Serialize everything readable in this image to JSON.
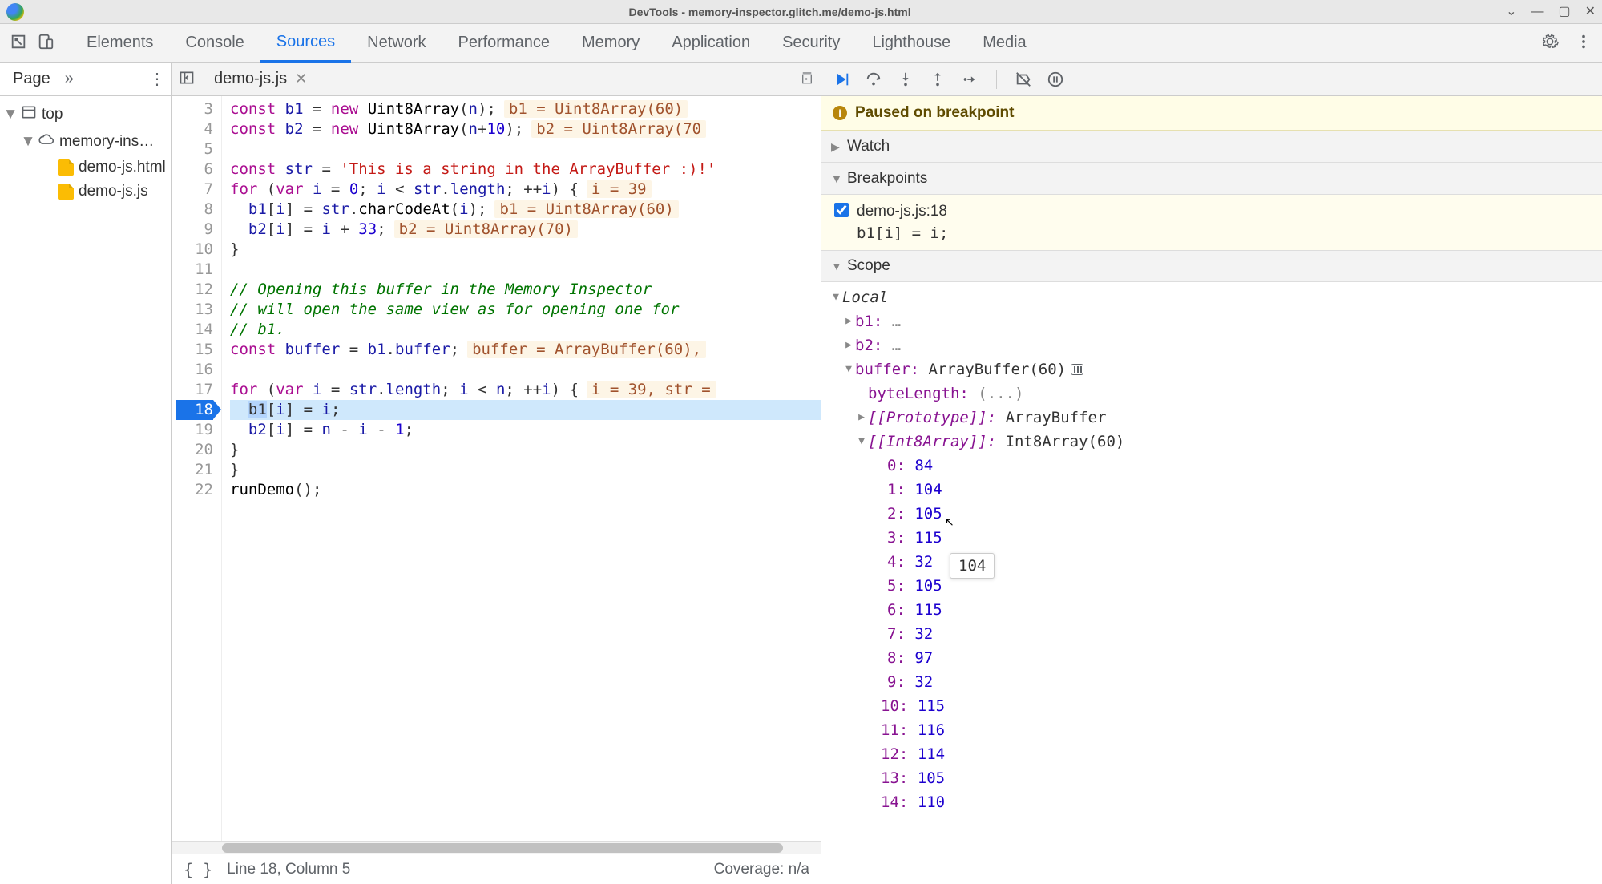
{
  "window": {
    "title": "DevTools - memory-inspector.glitch.me/demo-js.html"
  },
  "panel_tabs": [
    "Elements",
    "Console",
    "Sources",
    "Network",
    "Performance",
    "Memory",
    "Application",
    "Security",
    "Lighthouse",
    "Media"
  ],
  "active_panel": "Sources",
  "navigator": {
    "tab_label": "Page",
    "top_label": "top",
    "domain_label": "memory-ins…",
    "files": [
      "demo-js.html",
      "demo-js.js"
    ]
  },
  "open_file_tab": "demo-js.js",
  "editor": {
    "first_line_number": 3,
    "breakpoint_line": 18,
    "lines": [
      {
        "n": 3,
        "html": "<span class='tok-kw'>const</span> <span class='tok-var'>b1</span> <span class='tok-op'>=</span> <span class='tok-kw'>new</span> <span class='tok-fn'>Uint8Array</span>(<span class='tok-var'>n</span>);",
        "inline": "b1 = Uint8Array(60)"
      },
      {
        "n": 4,
        "html": "<span class='tok-kw'>const</span> <span class='tok-var'>b2</span> <span class='tok-op'>=</span> <span class='tok-kw'>new</span> <span class='tok-fn'>Uint8Array</span>(<span class='tok-var'>n</span><span class='tok-op'>+</span><span class='tok-num'>10</span>);",
        "inline": "b2 = Uint8Array(70"
      },
      {
        "n": 5,
        "html": ""
      },
      {
        "n": 6,
        "html": "<span class='tok-kw'>const</span> <span class='tok-var'>str</span> <span class='tok-op'>=</span> <span class='tok-str'>'This is a string in the ArrayBuffer :)!'</span>"
      },
      {
        "n": 7,
        "html": "<span class='tok-kw'>for</span> (<span class='tok-kw'>var</span> <span class='tok-var'>i</span> <span class='tok-op'>=</span> <span class='tok-num'>0</span>; <span class='tok-var'>i</span> <span class='tok-op'>&lt;</span> <span class='tok-var'>str</span>.<span class='tok-var'>length</span>; <span class='tok-op'>++</span><span class='tok-var'>i</span>) {",
        "inline": "i = 39"
      },
      {
        "n": 8,
        "html": "  <span class='tok-var'>b1</span>[<span class='tok-var'>i</span>] <span class='tok-op'>=</span> <span class='tok-var'>str</span>.<span class='tok-fn'>charCodeAt</span>(<span class='tok-var'>i</span>);",
        "inline": "b1 = Uint8Array(60)"
      },
      {
        "n": 9,
        "html": "  <span class='tok-var'>b2</span>[<span class='tok-var'>i</span>] <span class='tok-op'>=</span> <span class='tok-var'>i</span> <span class='tok-op'>+</span> <span class='tok-num'>33</span>;",
        "inline": "b2 = Uint8Array(70)"
      },
      {
        "n": 10,
        "html": "}"
      },
      {
        "n": 11,
        "html": ""
      },
      {
        "n": 12,
        "html": "<span class='tok-cm'>// Opening this buffer in the Memory Inspector</span>"
      },
      {
        "n": 13,
        "html": "<span class='tok-cm'>// will open the same view as for opening one for</span>"
      },
      {
        "n": 14,
        "html": "<span class='tok-cm'>// b1.</span>"
      },
      {
        "n": 15,
        "html": "<span class='tok-kw'>const</span> <span class='tok-var'>buffer</span> <span class='tok-op'>=</span> <span class='tok-var'>b1</span>.<span class='tok-var'>buffer</span>;",
        "inline": "buffer = ArrayBuffer(60),"
      },
      {
        "n": 16,
        "html": ""
      },
      {
        "n": 17,
        "html": "<span class='tok-kw'>for</span> (<span class='tok-kw'>var</span> <span class='tok-var'>i</span> <span class='tok-op'>=</span> <span class='tok-var'>str</span>.<span class='tok-var'>length</span>; <span class='tok-var'>i</span> <span class='tok-op'>&lt;</span> <span class='tok-var'>n</span>; <span class='tok-op'>++</span><span class='tok-var'>i</span>) {",
        "inline": "i = 39, str ="
      },
      {
        "n": 18,
        "html": "  <span class='paused-token'>b1</span>[<span class='tok-var'>i</span>] <span class='tok-op'>=</span> <span class='tok-var'>i</span>;",
        "paused": true
      },
      {
        "n": 19,
        "html": "  <span class='tok-var'>b2</span>[<span class='tok-var'>i</span>] <span class='tok-op'>=</span> <span class='tok-var'>n</span> <span class='tok-op'>-</span> <span class='tok-var'>i</span> <span class='tok-op'>-</span> <span class='tok-num'>1</span>;"
      },
      {
        "n": 20,
        "html": "}"
      },
      {
        "n": 21,
        "html": "}"
      },
      {
        "n": 22,
        "html": "<span class='tok-fn'>runDemo</span>();"
      }
    ]
  },
  "status_bar": {
    "position": "Line 18, Column 5",
    "coverage": "Coverage: n/a"
  },
  "debugger": {
    "paused_banner": "Paused on breakpoint",
    "sections": {
      "watch": "Watch",
      "breakpoints": "Breakpoints",
      "scope": "Scope"
    },
    "breakpoint": {
      "location": "demo-js.js:18",
      "code": "b1[i] = i;",
      "enabled": true
    },
    "scope": {
      "local_label": "Local",
      "b1_label": "b1:",
      "b1_val": "…",
      "b2_label": "b2:",
      "b2_val": "…",
      "buffer_label": "buffer:",
      "buffer_val": "ArrayBuffer(60)",
      "byteLength_label": "byteLength:",
      "byteLength_val": "(...)",
      "prototype_label": "[[Prototype]]:",
      "prototype_val": "ArrayBuffer",
      "int8_label": "[[Int8Array]]:",
      "int8_val": "Int8Array(60)",
      "array_values": [
        84,
        104,
        105,
        115,
        32,
        105,
        115,
        32,
        97,
        32,
        115,
        116,
        114,
        105,
        110
      ]
    },
    "tooltip": "104"
  }
}
